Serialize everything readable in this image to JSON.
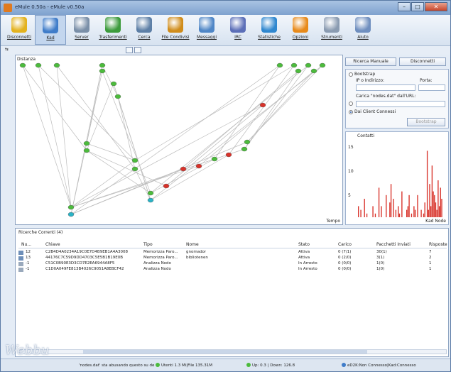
{
  "window": {
    "title": "eMule 0.50a - eMule v0.50a"
  },
  "colors": {
    "accent": "#2a5db0",
    "node_green": "#4cbb3c",
    "node_red": "#d8322a",
    "node_cyan": "#2ab3c6",
    "edge": "#bcbcbc"
  },
  "toolbar": {
    "items": [
      {
        "label": "Disconnetti",
        "icon": "disconnect-icon",
        "color": "#e3b21e"
      },
      {
        "label": "Kad",
        "icon": "kad-icon",
        "color": "#3f7cc9"
      },
      {
        "label": "Server",
        "icon": "server-icon",
        "color": "#7a8fa8"
      },
      {
        "label": "Trasferimenti",
        "icon": "transfer-icon",
        "color": "#3c9b3c"
      },
      {
        "label": "Cerca",
        "icon": "search-icon",
        "color": "#5d7fa6"
      },
      {
        "label": "File Condivisi",
        "icon": "shared-icon",
        "color": "#d08c1a"
      },
      {
        "label": "Messaggi",
        "icon": "messages-icon",
        "color": "#4f86c6"
      },
      {
        "label": "IRC",
        "icon": "irc-icon",
        "color": "#5c6fb8"
      },
      {
        "label": "Statistiche",
        "icon": "stats-icon",
        "color": "#2f87cf"
      },
      {
        "label": "Opzioni",
        "icon": "options-icon",
        "color": "#e88a1a"
      },
      {
        "label": "Strumenti",
        "icon": "tools-icon",
        "color": "#8a9bb1"
      },
      {
        "label": "Aiuto",
        "icon": "help-icon",
        "color": "#6f8fbf"
      }
    ],
    "active_index": 1
  },
  "graph": {
    "header": "Distanza",
    "footer": "Tempo"
  },
  "right": {
    "connect_btn": "Ricerca Manuale",
    "disconnect_btn": "Disconnetti",
    "bootstrap_label": "Bootstrap",
    "ip_label": "IP o Indirizzo:",
    "port_label": "Porta:",
    "url_label": "Carica \"nodes.dat\" dall'URL:",
    "clients_label": "Dai Client Connessi",
    "bootstrap_btn": "Bootstrap",
    "histo_title": "Contatti",
    "histo_ylabels": [
      "15",
      "10",
      "5"
    ],
    "histo_xlabel": "Kad Node"
  },
  "search": {
    "title": "Ricerche Correnti (4)",
    "columns": [
      "Nu...",
      "Chiave",
      "Tipo",
      "Nome",
      "Stato",
      "Carico",
      "Pacchetti Inviati",
      "Risposte"
    ],
    "rows": [
      [
        "12",
        "C2B4D4A0234A19C0E7D4B9EB1A4A3008",
        "Memorizza Paro...",
        "gnomador",
        "Attiva",
        "0 (7/1)",
        "30(1)",
        "7"
      ],
      [
        "13",
        "44176C7C59D9DD4703C5E5B1B19E0B",
        "Memorizza Paro...",
        "bibliotenen",
        "Attiva",
        "0 (2/0)",
        "3(1)",
        "2"
      ],
      [
        "-1",
        "C51C0B90E3D3CD7E2EA6944A8F5",
        "Analizza Nodo",
        "",
        "In Arresto",
        "0 (0/0)",
        "1(0)",
        "1"
      ],
      [
        "-1",
        "C1D0A049FE813B4026C9051A8EBCF42",
        "Analizza Nodo",
        "",
        "In Arresto",
        "0 (0/0)",
        "1(0)",
        "1"
      ]
    ]
  },
  "status": {
    "logo": "Webbu",
    "msg": "'nodes.dat' sta abusando questo su de",
    "users": "Utenti 1.3 Mi|File 135.31M",
    "updown": "Up: 0.3 | Down: 126.8",
    "network": "eD2K:Non Connesso|Kad:Connesso"
  }
}
